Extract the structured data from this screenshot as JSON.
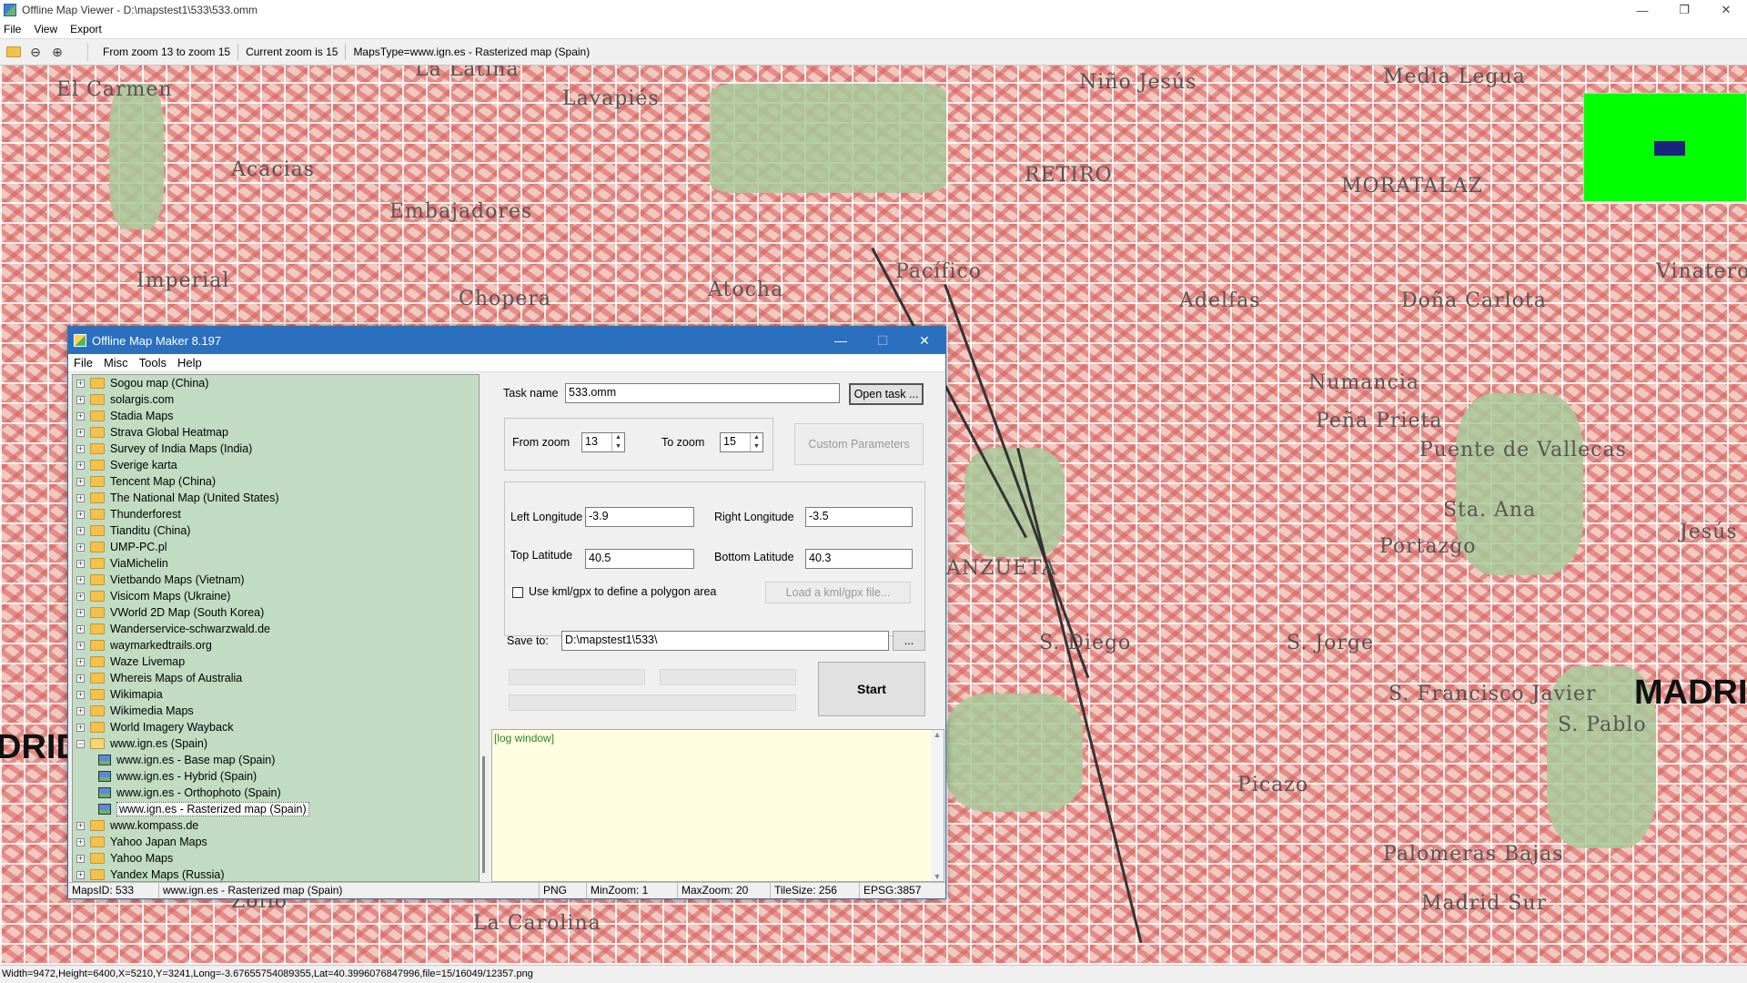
{
  "viewer": {
    "title": "Offline Map Viewer - D:\\mapstest1\\533\\533.omm",
    "menu": [
      "File",
      "View",
      "Export"
    ],
    "toolbar": {
      "zoom_range": "From zoom 13 to zoom 15",
      "current_zoom": "Current zoom is 15",
      "maps_type": "MapsType=www.ign.es - Rasterized map (Spain)"
    },
    "status": "Width=9472,Height=6400,X=5210,Y=3241,Long=-3.67655754089355,Lat=40.3996076847996,file=15/16049/12357.png"
  },
  "map_labels": [
    "El Carmen",
    "La Latina",
    "Lavapiés",
    "Niño Jesús",
    "Media Legua",
    "Acacias",
    "Embajadores",
    "RETIRO",
    "MORATALAZ",
    "Imperial",
    "Chopera",
    "Atocha",
    "Pacífico",
    "Adelfas",
    "Doña Carlota",
    "Vinateros",
    "Numancia",
    "Peña Prieta",
    "Puente de Vallecas",
    "Sta. Ana",
    "Portazgo",
    "ANZUETA",
    "S. Diego",
    "S. Jorge",
    "S. Francisco Javier",
    "S. Pablo",
    "Picazo",
    "Palomeras Bajas",
    "Madrid Sur",
    "La Carolina",
    "Zofio",
    "Jesús"
  ],
  "map_big_label": "MADRI",
  "map_left_label": "DRID",
  "maker": {
    "title": "Offline Map Maker 8.197",
    "menu": [
      "File",
      "Misc",
      "Tools",
      "Help"
    ],
    "tree": [
      {
        "label": "Sogou map (China)"
      },
      {
        "label": "solargis.com"
      },
      {
        "label": "Stadia Maps"
      },
      {
        "label": "Strava Global Heatmap"
      },
      {
        "label": "Survey of India Maps (India)"
      },
      {
        "label": "Sverige karta"
      },
      {
        "label": "Tencent Map (China)"
      },
      {
        "label": "The National Map (United States)"
      },
      {
        "label": "Thunderforest"
      },
      {
        "label": "Tianditu (China)"
      },
      {
        "label": "UMP-PC.pl"
      },
      {
        "label": "ViaMichelin"
      },
      {
        "label": "Vietbando Maps (Vietnam)"
      },
      {
        "label": "Visicom Maps (Ukraine)"
      },
      {
        "label": "VWorld 2D Map (South Korea)"
      },
      {
        "label": "Wanderservice-schwarzwald.de"
      },
      {
        "label": "waymarkedtrails.org"
      },
      {
        "label": "Waze Livemap"
      },
      {
        "label": "Whereis Maps of Australia"
      },
      {
        "label": "Wikimapia"
      },
      {
        "label": "Wikimedia Maps"
      },
      {
        "label": "World Imagery Wayback"
      },
      {
        "label": "www.ign.es (Spain)",
        "expanded": true
      },
      {
        "label": "www.ign.es - Base map (Spain)",
        "child": true
      },
      {
        "label": "www.ign.es - Hybrid (Spain)",
        "child": true
      },
      {
        "label": "www.ign.es - Orthophoto (Spain)",
        "child": true
      },
      {
        "label": "www.ign.es - Rasterized map (Spain)",
        "child": true,
        "selected": true
      },
      {
        "label": "www.kompass.de"
      },
      {
        "label": "Yahoo Japan Maps"
      },
      {
        "label": "Yahoo Maps"
      },
      {
        "label": "Yandex Maps (Russia)"
      }
    ],
    "task_name_label": "Task name",
    "task_name_value": "533.omm",
    "open_task_label": "Open task ...",
    "from_zoom_label": "From zoom",
    "from_zoom_value": "13",
    "to_zoom_label": "To zoom",
    "to_zoom_value": "15",
    "custom_params_label": "Custom Parameters",
    "left_lon_label": "Left Longitude",
    "left_lon_value": "-3.9",
    "right_lon_label": "Right Longitude",
    "right_lon_value": "-3.5",
    "top_lat_label": "Top Latitude",
    "top_lat_value": "40.5",
    "bottom_lat_label": "Bottom Latitude",
    "bottom_lat_value": "40.3",
    "kml_checkbox_label": "Use kml/gpx to define a polygon area",
    "load_kml_label": "Load a kml/gpx file...",
    "save_to_label": "Save to:",
    "save_to_value": "D:\\mapstest1\\533\\",
    "browse_label": "...",
    "start_label": "Start",
    "log_text": "[log window]",
    "status": {
      "maps_id": "MapsID: 533",
      "map_name": "www.ign.es - Rasterized map (Spain)",
      "format": "PNG",
      "min_zoom": "MinZoom: 1",
      "max_zoom": "MaxZoom: 20",
      "tile_size": "TileSize: 256",
      "epsg": "EPSG:3857"
    }
  }
}
